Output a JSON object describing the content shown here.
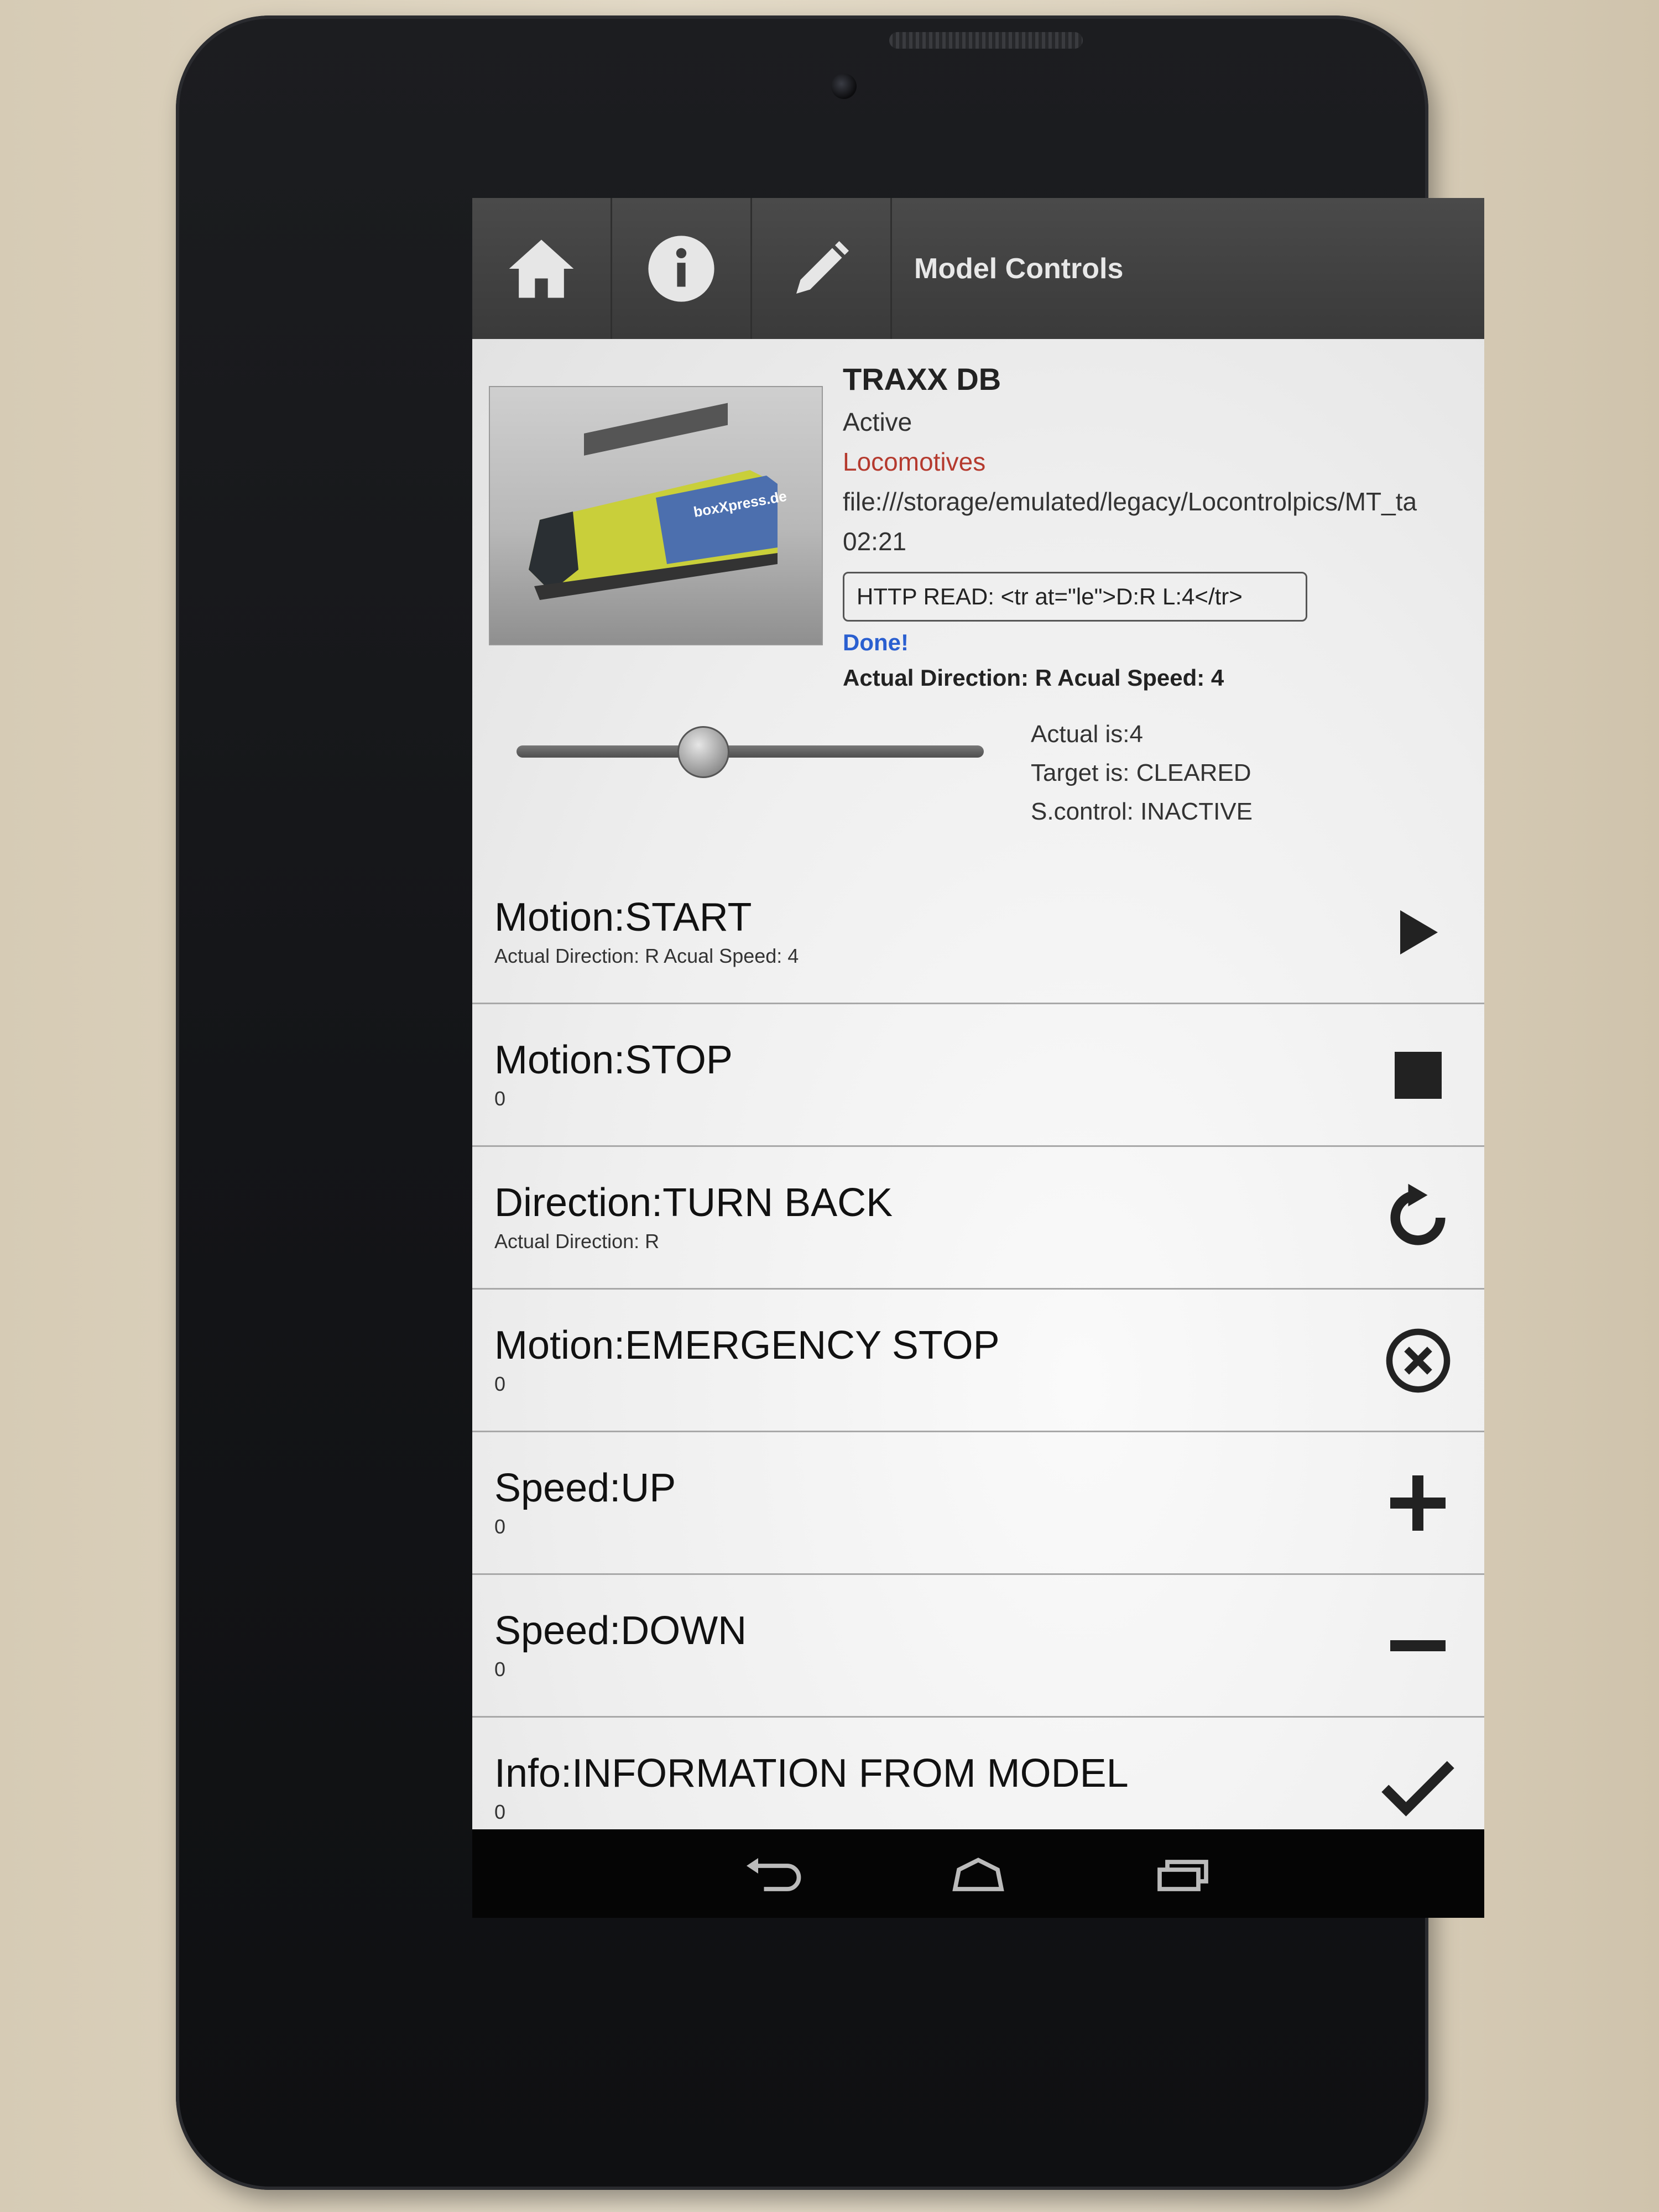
{
  "actionbar": {
    "title": "Model Controls",
    "icons": [
      "home-icon",
      "info-icon",
      "pencil-icon"
    ]
  },
  "model": {
    "name": "TRAXX DB",
    "state": "Active",
    "category": "Locomotives",
    "path": "file:///storage/emulated/legacy/Locontrolpics/MT_ta",
    "time": "02:21",
    "http": "HTTP READ: <tr at=\"le\">D:R L:4</tr>",
    "done": "Done!",
    "actual_line": "Actual Direction: R   Acual Speed: 4",
    "photo_label": "boxXpress.de"
  },
  "speed_slider": {
    "value_fraction": 0.4
  },
  "status": {
    "actual": "Actual is:4",
    "target": "Target is: CLEARED",
    "scontrol": "S.control: INACTIVE"
  },
  "controls": [
    {
      "title": "Motion:START",
      "sub": "Actual Direction: R   Acual Speed: 4",
      "icon": "play-icon"
    },
    {
      "title": "Motion:STOP",
      "sub": "0",
      "icon": "stop-icon"
    },
    {
      "title": "Direction:TURN BACK",
      "sub": "Actual Direction: R",
      "icon": "refresh-icon"
    },
    {
      "title": "Motion:EMERGENCY STOP",
      "sub": "0",
      "icon": "cancel-circle-icon"
    },
    {
      "title": "Speed:UP",
      "sub": "0",
      "icon": "plus-icon"
    },
    {
      "title": "Speed:DOWN",
      "sub": "0",
      "icon": "minus-icon"
    },
    {
      "title": "Info:INFORMATION FROM MODEL",
      "sub": "0",
      "icon": "checkmark-icon"
    }
  ],
  "navbar": [
    "back-icon",
    "home-nav-icon",
    "recents-icon"
  ],
  "colors": {
    "accent_red": "#b53a2e",
    "accent_blue": "#2a5fd0",
    "actionbar": "#3f3f3f"
  }
}
